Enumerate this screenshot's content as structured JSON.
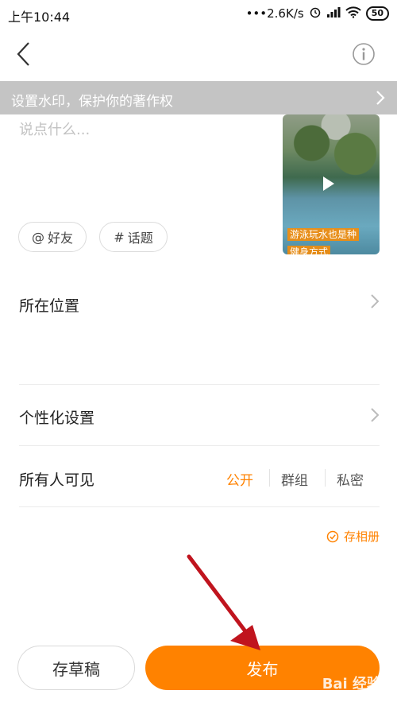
{
  "status_bar": {
    "time": "上午10:44",
    "network_speed": "•••2.6K/s",
    "battery": "50"
  },
  "banner": {
    "text": "设置水印，保护你的著作权"
  },
  "composer": {
    "placeholder": "说点什么..."
  },
  "video": {
    "caption_line1": "游泳玩水也是种",
    "caption_line2": "健身方式"
  },
  "tags": {
    "friend": "好友",
    "topic": "话题"
  },
  "rows": {
    "location": "所在位置",
    "personalize": "个性化设置",
    "visibility": "所有人可见"
  },
  "visibility_options": [
    {
      "label": "公开",
      "selected": true
    },
    {
      "label": "群组",
      "selected": false
    },
    {
      "label": "私密",
      "selected": false
    }
  ],
  "save_album": "存相册",
  "buttons": {
    "draft": "存草稿",
    "publish": "发布"
  },
  "watermark": "Bai 经验",
  "colors": {
    "accent": "#ff8200",
    "banner": "#c4c4c4",
    "annotation_arrow": "#c0141e"
  }
}
